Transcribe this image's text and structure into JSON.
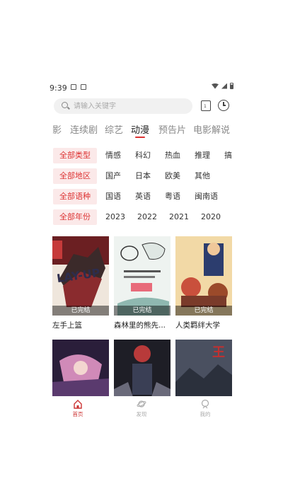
{
  "status": {
    "time": "9:39"
  },
  "search": {
    "placeholder": "请输入关键字"
  },
  "calendar_day": "1",
  "tabs": [
    "影",
    "连续剧",
    "综艺",
    "动漫",
    "预告片",
    "电影解说"
  ],
  "active_tab": "动漫",
  "filters": {
    "type": [
      "全部类型",
      "情感",
      "科幻",
      "热血",
      "推理",
      "搞"
    ],
    "region": [
      "全部地区",
      "国产",
      "日本",
      "欧美",
      "其他"
    ],
    "language": [
      "全部语种",
      "国语",
      "英语",
      "粤语",
      "闽南语"
    ],
    "year": [
      "全部年份",
      "2023",
      "2022",
      "2021",
      "2020"
    ]
  },
  "cards": [
    {
      "title": "左手上篮",
      "badge": "已完结"
    },
    {
      "title": "森林里的熊先...",
      "badge": "已完结"
    },
    {
      "title": "人类羁绊大学",
      "badge": "已完结"
    },
    {
      "title": "",
      "badge": ""
    },
    {
      "title": "",
      "badge": ""
    },
    {
      "title": "",
      "badge": ""
    }
  ],
  "poster_text": {
    "p1": "LAY-UP",
    "p3": "王"
  },
  "bottom_nav": [
    {
      "label": "首页",
      "icon": "home-icon"
    },
    {
      "label": "发现",
      "icon": "planet-icon"
    },
    {
      "label": "我的",
      "icon": "profile-icon"
    }
  ],
  "colors": {
    "accent": "#d33333",
    "chip_bg": "#fbe9e9"
  }
}
